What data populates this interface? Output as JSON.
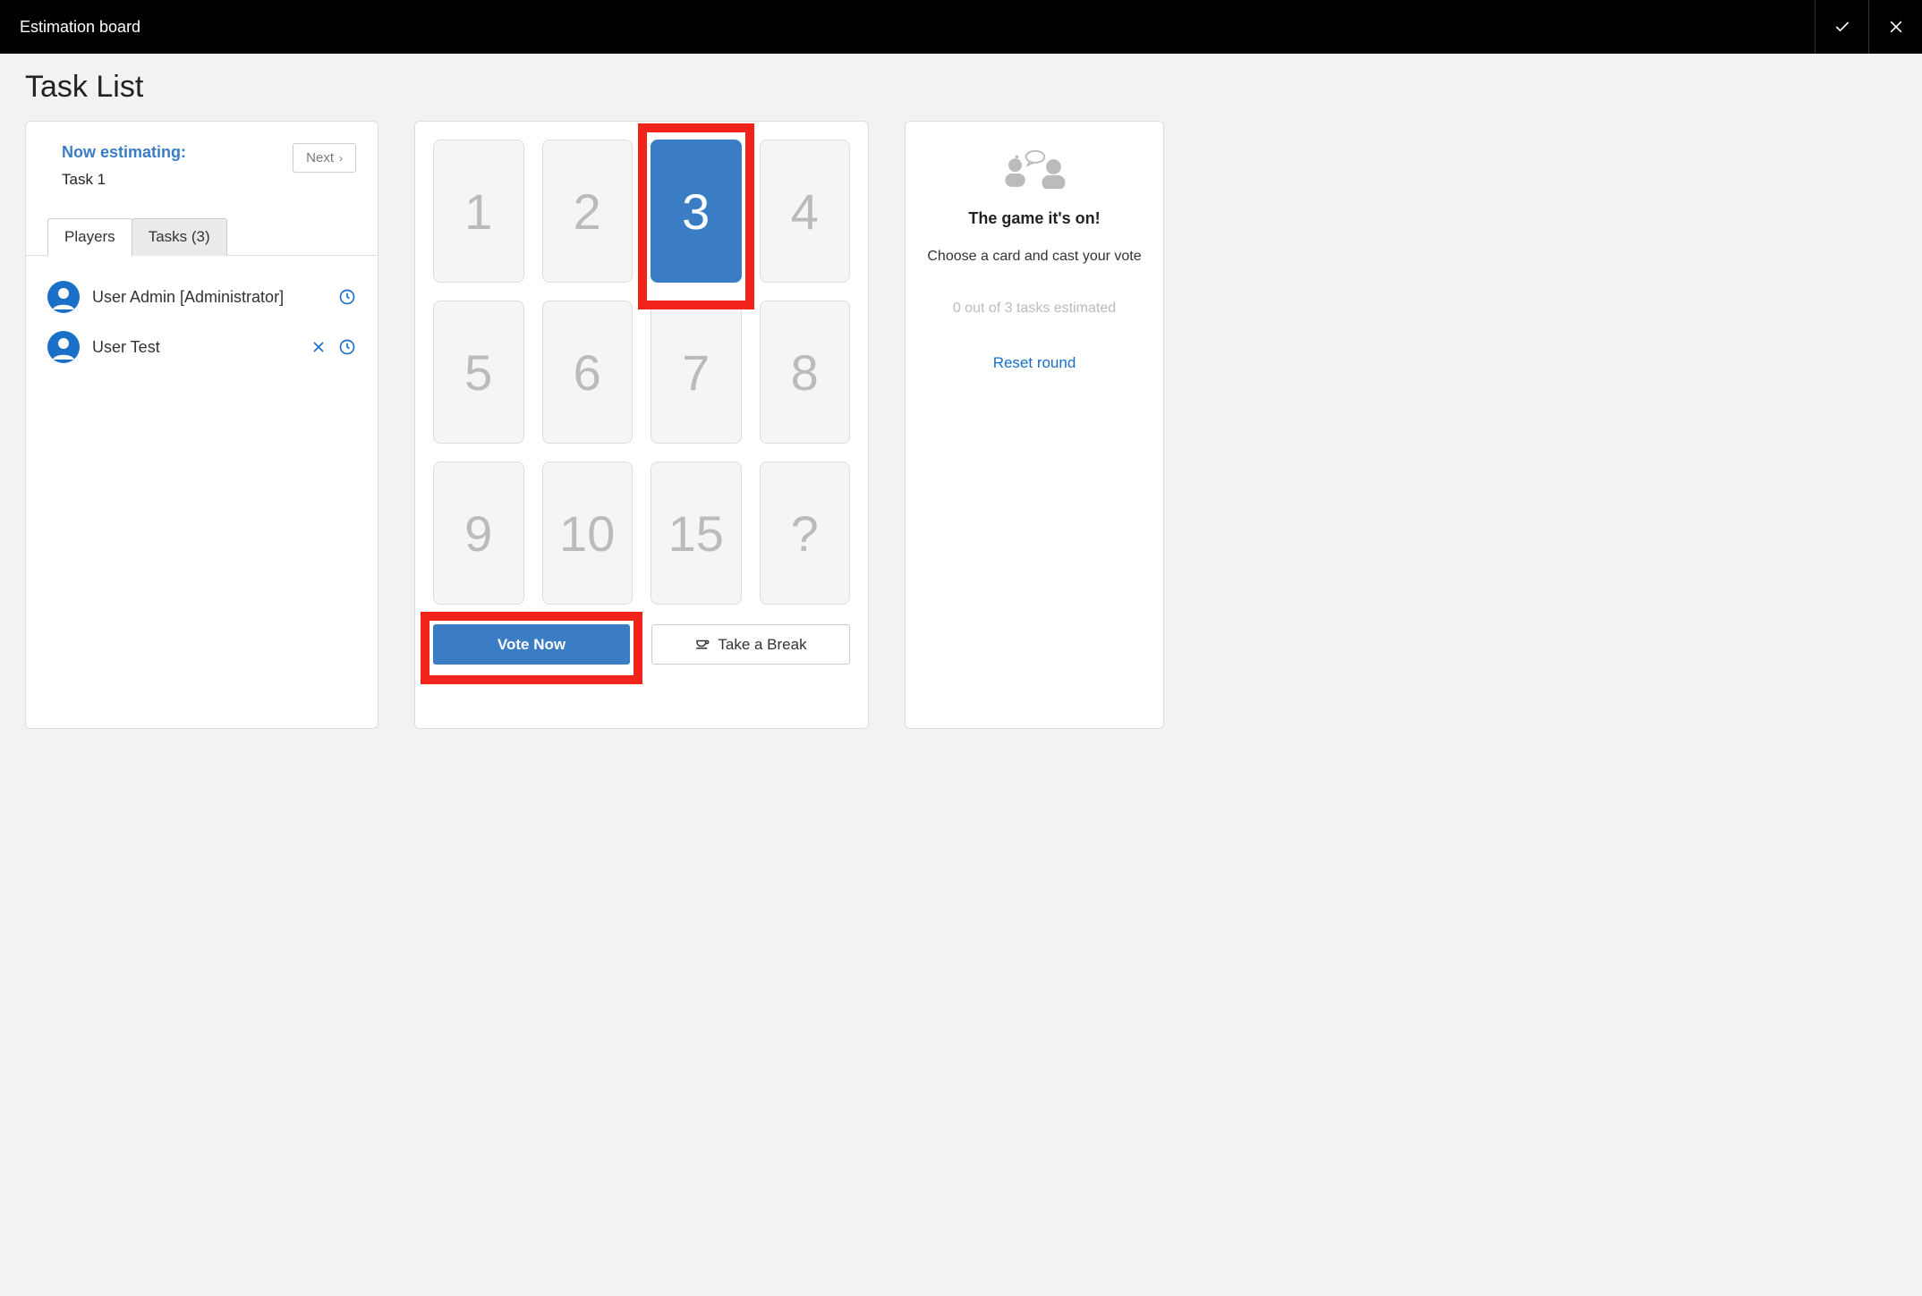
{
  "header": {
    "title": "Estimation board"
  },
  "page": {
    "heading": "Task List"
  },
  "left": {
    "now_estimating_label": "Now estimating:",
    "current_task": "Task 1",
    "next_button": "Next",
    "tabs": {
      "players": "Players",
      "tasks": "Tasks (3)"
    },
    "players": [
      {
        "name": "User Admin [Administrator]"
      },
      {
        "name": "User Test"
      }
    ]
  },
  "cards": {
    "values": [
      "1",
      "2",
      "3",
      "4",
      "5",
      "6",
      "7",
      "8",
      "9",
      "10",
      "15",
      "?"
    ],
    "selected": "3",
    "vote_button": "Vote Now",
    "break_button": "Take a Break"
  },
  "right": {
    "title": "The game it's on!",
    "instruction": "Choose a card and cast your vote",
    "progress": "0 out of 3 tasks estimated",
    "reset": "Reset round"
  }
}
